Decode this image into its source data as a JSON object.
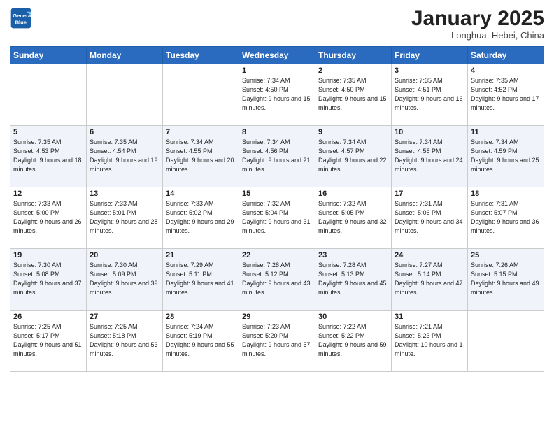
{
  "header": {
    "logo_line1": "General",
    "logo_line2": "Blue",
    "month": "January 2025",
    "location": "Longhua, Hebei, China"
  },
  "weekdays": [
    "Sunday",
    "Monday",
    "Tuesday",
    "Wednesday",
    "Thursday",
    "Friday",
    "Saturday"
  ],
  "weeks": [
    [
      {
        "day": "",
        "sunrise": "",
        "sunset": "",
        "daylight": ""
      },
      {
        "day": "",
        "sunrise": "",
        "sunset": "",
        "daylight": ""
      },
      {
        "day": "",
        "sunrise": "",
        "sunset": "",
        "daylight": ""
      },
      {
        "day": "1",
        "sunrise": "Sunrise: 7:34 AM",
        "sunset": "Sunset: 4:50 PM",
        "daylight": "Daylight: 9 hours and 15 minutes."
      },
      {
        "day": "2",
        "sunrise": "Sunrise: 7:35 AM",
        "sunset": "Sunset: 4:50 PM",
        "daylight": "Daylight: 9 hours and 15 minutes."
      },
      {
        "day": "3",
        "sunrise": "Sunrise: 7:35 AM",
        "sunset": "Sunset: 4:51 PM",
        "daylight": "Daylight: 9 hours and 16 minutes."
      },
      {
        "day": "4",
        "sunrise": "Sunrise: 7:35 AM",
        "sunset": "Sunset: 4:52 PM",
        "daylight": "Daylight: 9 hours and 17 minutes."
      }
    ],
    [
      {
        "day": "5",
        "sunrise": "Sunrise: 7:35 AM",
        "sunset": "Sunset: 4:53 PM",
        "daylight": "Daylight: 9 hours and 18 minutes."
      },
      {
        "day": "6",
        "sunrise": "Sunrise: 7:35 AM",
        "sunset": "Sunset: 4:54 PM",
        "daylight": "Daylight: 9 hours and 19 minutes."
      },
      {
        "day": "7",
        "sunrise": "Sunrise: 7:34 AM",
        "sunset": "Sunset: 4:55 PM",
        "daylight": "Daylight: 9 hours and 20 minutes."
      },
      {
        "day": "8",
        "sunrise": "Sunrise: 7:34 AM",
        "sunset": "Sunset: 4:56 PM",
        "daylight": "Daylight: 9 hours and 21 minutes."
      },
      {
        "day": "9",
        "sunrise": "Sunrise: 7:34 AM",
        "sunset": "Sunset: 4:57 PM",
        "daylight": "Daylight: 9 hours and 22 minutes."
      },
      {
        "day": "10",
        "sunrise": "Sunrise: 7:34 AM",
        "sunset": "Sunset: 4:58 PM",
        "daylight": "Daylight: 9 hours and 24 minutes."
      },
      {
        "day": "11",
        "sunrise": "Sunrise: 7:34 AM",
        "sunset": "Sunset: 4:59 PM",
        "daylight": "Daylight: 9 hours and 25 minutes."
      }
    ],
    [
      {
        "day": "12",
        "sunrise": "Sunrise: 7:33 AM",
        "sunset": "Sunset: 5:00 PM",
        "daylight": "Daylight: 9 hours and 26 minutes."
      },
      {
        "day": "13",
        "sunrise": "Sunrise: 7:33 AM",
        "sunset": "Sunset: 5:01 PM",
        "daylight": "Daylight: 9 hours and 28 minutes."
      },
      {
        "day": "14",
        "sunrise": "Sunrise: 7:33 AM",
        "sunset": "Sunset: 5:02 PM",
        "daylight": "Daylight: 9 hours and 29 minutes."
      },
      {
        "day": "15",
        "sunrise": "Sunrise: 7:32 AM",
        "sunset": "Sunset: 5:04 PM",
        "daylight": "Daylight: 9 hours and 31 minutes."
      },
      {
        "day": "16",
        "sunrise": "Sunrise: 7:32 AM",
        "sunset": "Sunset: 5:05 PM",
        "daylight": "Daylight: 9 hours and 32 minutes."
      },
      {
        "day": "17",
        "sunrise": "Sunrise: 7:31 AM",
        "sunset": "Sunset: 5:06 PM",
        "daylight": "Daylight: 9 hours and 34 minutes."
      },
      {
        "day": "18",
        "sunrise": "Sunrise: 7:31 AM",
        "sunset": "Sunset: 5:07 PM",
        "daylight": "Daylight: 9 hours and 36 minutes."
      }
    ],
    [
      {
        "day": "19",
        "sunrise": "Sunrise: 7:30 AM",
        "sunset": "Sunset: 5:08 PM",
        "daylight": "Daylight: 9 hours and 37 minutes."
      },
      {
        "day": "20",
        "sunrise": "Sunrise: 7:30 AM",
        "sunset": "Sunset: 5:09 PM",
        "daylight": "Daylight: 9 hours and 39 minutes."
      },
      {
        "day": "21",
        "sunrise": "Sunrise: 7:29 AM",
        "sunset": "Sunset: 5:11 PM",
        "daylight": "Daylight: 9 hours and 41 minutes."
      },
      {
        "day": "22",
        "sunrise": "Sunrise: 7:28 AM",
        "sunset": "Sunset: 5:12 PM",
        "daylight": "Daylight: 9 hours and 43 minutes."
      },
      {
        "day": "23",
        "sunrise": "Sunrise: 7:28 AM",
        "sunset": "Sunset: 5:13 PM",
        "daylight": "Daylight: 9 hours and 45 minutes."
      },
      {
        "day": "24",
        "sunrise": "Sunrise: 7:27 AM",
        "sunset": "Sunset: 5:14 PM",
        "daylight": "Daylight: 9 hours and 47 minutes."
      },
      {
        "day": "25",
        "sunrise": "Sunrise: 7:26 AM",
        "sunset": "Sunset: 5:15 PM",
        "daylight": "Daylight: 9 hours and 49 minutes."
      }
    ],
    [
      {
        "day": "26",
        "sunrise": "Sunrise: 7:25 AM",
        "sunset": "Sunset: 5:17 PM",
        "daylight": "Daylight: 9 hours and 51 minutes."
      },
      {
        "day": "27",
        "sunrise": "Sunrise: 7:25 AM",
        "sunset": "Sunset: 5:18 PM",
        "daylight": "Daylight: 9 hours and 53 minutes."
      },
      {
        "day": "28",
        "sunrise": "Sunrise: 7:24 AM",
        "sunset": "Sunset: 5:19 PM",
        "daylight": "Daylight: 9 hours and 55 minutes."
      },
      {
        "day": "29",
        "sunrise": "Sunrise: 7:23 AM",
        "sunset": "Sunset: 5:20 PM",
        "daylight": "Daylight: 9 hours and 57 minutes."
      },
      {
        "day": "30",
        "sunrise": "Sunrise: 7:22 AM",
        "sunset": "Sunset: 5:22 PM",
        "daylight": "Daylight: 9 hours and 59 minutes."
      },
      {
        "day": "31",
        "sunrise": "Sunrise: 7:21 AM",
        "sunset": "Sunset: 5:23 PM",
        "daylight": "Daylight: 10 hours and 1 minute."
      },
      {
        "day": "",
        "sunrise": "",
        "sunset": "",
        "daylight": ""
      }
    ]
  ]
}
